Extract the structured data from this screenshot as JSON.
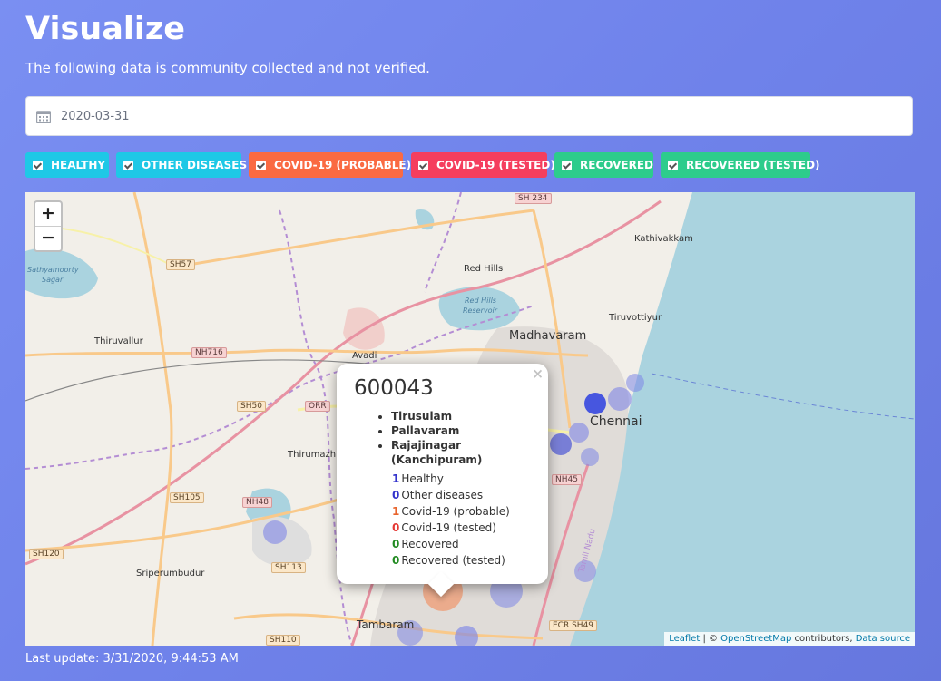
{
  "header": {
    "title": "Visualize",
    "subtitle": "The following data is community collected and not verified."
  },
  "date_input": {
    "value": "2020-03-31",
    "icon": "calendar-icon"
  },
  "filters": [
    {
      "label": "HEALTHY",
      "color": "#1ec8e6",
      "checked": true
    },
    {
      "label": "OTHER DISEASES",
      "color": "#1ec8e6",
      "checked": true
    },
    {
      "label": "COVID-19 (PROBABLE)",
      "color": "#fa6a42",
      "checked": true
    },
    {
      "label": "COVID-19 (TESTED)",
      "color": "#f53e5e",
      "checked": true
    },
    {
      "label": "RECOVERED",
      "color": "#2dcc8c",
      "checked": true
    },
    {
      "label": "RECOVERED (TESTED)",
      "color": "#2dcc8c",
      "checked": true
    }
  ],
  "map": {
    "zoom_in": "+",
    "zoom_out": "−",
    "place_labels": {
      "kathivakkam": "Kathivakkam",
      "sathyamoorty": "Sathyamoorty",
      "sagar": "Sagar",
      "red_hills": "Red Hills",
      "red_hills_res1": "Red Hills",
      "red_hills_res2": "Reservoir",
      "tiruvottiyur": "Tiruvottiyur",
      "madhavaram": "Madhavaram",
      "thiruvallur": "Thiruvallur",
      "avadi": "Avadi",
      "chennai": "Chennai",
      "thirumazh": "Thirumazh",
      "sriperumbudur": "Sriperumbudur",
      "tambaram": "Tambaram",
      "tamil_nadu": "Tamil Nadu"
    },
    "road_shields": {
      "sh234": "SH 234",
      "sh57": "SH57",
      "nh716": "NH716",
      "sh50": "SH50",
      "orr": "ORR",
      "sh105": "SH105",
      "nh48": "NH48",
      "sh120": "SH120",
      "sh113": "SH113",
      "nh45": "NH45",
      "sh110": "SH110",
      "ecr": "ECR SH49"
    },
    "attribution": {
      "leaflet": "Leaflet",
      "sep": " | © ",
      "osm": "OpenStreetMap",
      "contrib": " contributors, ",
      "source": "Data source"
    }
  },
  "popup": {
    "close": "×",
    "pincode": "600043",
    "areas": [
      "Tirusulam",
      "Pallavaram",
      "Rajajinagar (Kanchipuram)"
    ],
    "counts": [
      {
        "value": "1",
        "label": "Healthy",
        "color": "#3333cc"
      },
      {
        "value": "0",
        "label": "Other diseases",
        "color": "#3333cc"
      },
      {
        "value": "1",
        "label": "Covid-19 (probable)",
        "color": "#e8642c"
      },
      {
        "value": "0",
        "label": "Covid-19 (tested)",
        "color": "#e53935"
      },
      {
        "value": "0",
        "label": "Recovered",
        "color": "#228b22"
      },
      {
        "value": "0",
        "label": "Recovered (tested)",
        "color": "#228b22"
      }
    ]
  },
  "footer": {
    "last_update": "Last update: 3/31/2020, 9:44:53 AM"
  }
}
